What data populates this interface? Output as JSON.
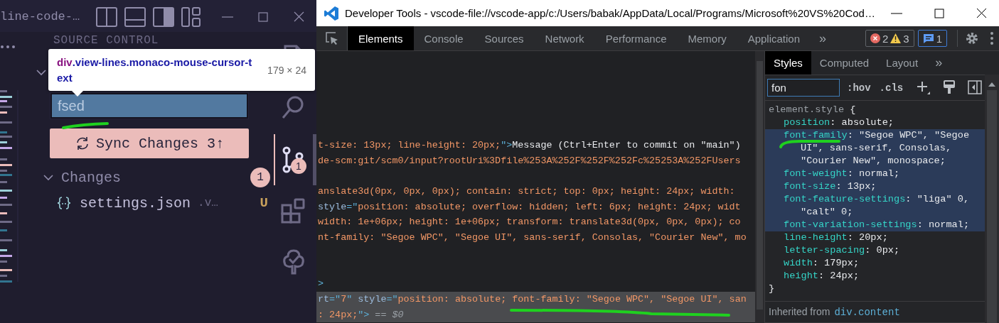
{
  "vscode": {
    "title": "line-code-…",
    "sidebar_title": "SOURCE CONTROL",
    "repository": {
      "expanded": true
    },
    "commit_input": {
      "value": "fsed",
      "highlighted": true
    },
    "sync_button": {
      "label": "Sync Changes 3↑"
    },
    "changes_group": {
      "label": "Changes",
      "count": "1",
      "expanded": true
    },
    "files": [
      {
        "name": "settings.json",
        "path": ".v…",
        "status": "U"
      }
    ],
    "activity_bar": [
      {
        "kind": "files",
        "selected": false
      },
      {
        "kind": "search",
        "selected": false
      },
      {
        "kind": "scm",
        "selected": true,
        "badge": "1"
      },
      {
        "kind": "extensions",
        "selected": false
      },
      {
        "kind": "testing",
        "selected": false
      }
    ]
  },
  "inspect_tooltip": {
    "tag": "div",
    "classes": ".view-lines.monaco-mouse-cursor-text",
    "size": "179 × 24"
  },
  "devtools": {
    "title": "Developer Tools - vscode-file://vscode-app/c:/Users/babak/AppData/Local/Programs/Microsoft%20VS%20Cod…",
    "tabs": [
      {
        "label": "Elements",
        "selected": true
      },
      {
        "label": "Console",
        "selected": false
      },
      {
        "label": "Sources",
        "selected": false
      },
      {
        "label": "Network",
        "selected": false
      },
      {
        "label": "Performance",
        "selected": false
      },
      {
        "label": "Memory",
        "selected": false
      },
      {
        "label": "Application",
        "selected": false
      }
    ],
    "more_tabs": "»",
    "issues": {
      "errors": "2",
      "warnings": "3",
      "messages": "1"
    },
    "dom_lines": [
      {
        "selected": false,
        "segments": [
          {
            "kind": "value",
            "text": "t-size: 13px; line-height: 20px;"
          },
          {
            "kind": "tag",
            "text": "\">"
          },
          {
            "kind": "text",
            "text": "Message (Ctrl+Enter to commit on \"main\")"
          }
        ]
      },
      {
        "selected": false,
        "segments": [
          {
            "kind": "value",
            "text": "de-scm:git/scm0/input?rootUri%3Dfile%253A%252F%252F%252Fc%25253A%252FUsers"
          }
        ]
      },
      {
        "selected": false,
        "segments": [
          {
            "kind": "value",
            "text": "anslate3d(0px, 0px, 0px); contain: strict; top: 0px; height: 24px; width:"
          }
        ]
      },
      {
        "selected": false,
        "segments": [
          {
            "kind": "attr",
            "text": "style"
          },
          {
            "kind": "tag",
            "text": "=\""
          },
          {
            "kind": "value",
            "text": "position: absolute; overflow: hidden; left: 6px; height: 24px; widt"
          }
        ]
      },
      {
        "selected": false,
        "segments": [
          {
            "kind": "value",
            "text": "width: 1e+06px; height: 1e+06px; transform: translate3d(0px, 0px, 0px); co"
          }
        ]
      },
      {
        "selected": false,
        "segments": [
          {
            "kind": "value",
            "text": "nt-family: \"Segoe WPC\", \"Segoe UI\", sans-serif, Consolas, \"Courier New\", mo"
          }
        ]
      },
      {
        "selected": false,
        "segments": [
          {
            "kind": "tag",
            "text": ">"
          }
        ]
      },
      {
        "selected": true,
        "segments": [
          {
            "kind": "attr",
            "text": "rt"
          },
          {
            "kind": "tag",
            "text": "=\""
          },
          {
            "kind": "value",
            "text": "7"
          },
          {
            "kind": "tag",
            "text": "\" "
          },
          {
            "kind": "attr",
            "text": "style"
          },
          {
            "kind": "tag",
            "text": "=\""
          },
          {
            "kind": "value",
            "text": "position: absolute; font-family: \"Segoe WPC\", \"Segoe UI\", san"
          }
        ]
      },
      {
        "selected": true,
        "segments": [
          {
            "kind": "value",
            "text": ": 24px;"
          },
          {
            "kind": "tag",
            "text": "\">"
          },
          {
            "kind": "note",
            "text": " == $0"
          }
        ]
      }
    ],
    "styles": {
      "tabs": [
        {
          "label": "Styles",
          "selected": true
        },
        {
          "label": "Computed",
          "selected": false
        },
        {
          "label": "Layout",
          "selected": false
        }
      ],
      "more_tabs": "»",
      "filter": "fon",
      "toggles": [
        ":hov",
        ".cls"
      ],
      "rule": {
        "selector": "element.style",
        "open": "{",
        "close": "}",
        "declarations": [
          {
            "name": "position",
            "value": ": absolute;",
            "highlighted": false
          },
          {
            "name": "font-family",
            "value": ": \"Segoe WPC\", \"Segoe UI\", sans-serif, Consolas, \"Courier New\", monospace;",
            "highlighted": true
          },
          {
            "name": "font-weight",
            "value": ": normal;",
            "highlighted": true
          },
          {
            "name": "font-size",
            "value": ": 13px;",
            "highlighted": true
          },
          {
            "name": "font-feature-settings",
            "value": ": \"liga\" 0, \"calt\" 0;",
            "highlighted": true
          },
          {
            "name": "font-variation-settings",
            "value": ": normal;",
            "highlighted": true
          },
          {
            "name": "line-height",
            "value": ": 20px;",
            "highlighted": false
          },
          {
            "name": "letter-spacing",
            "value": ": 0px;",
            "highlighted": false
          },
          {
            "name": "width",
            "value": ": 179px;",
            "highlighted": false
          },
          {
            "name": "height",
            "value": ": 24px;",
            "highlighted": false
          }
        ]
      },
      "inherited": {
        "label": "Inherited from",
        "selector": "div.content"
      }
    }
  }
}
